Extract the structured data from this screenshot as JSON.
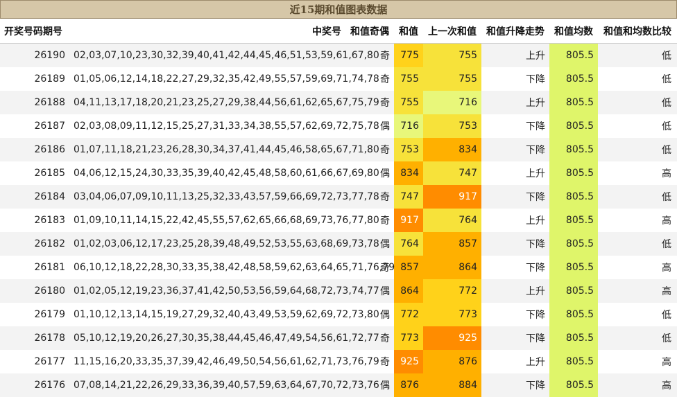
{
  "title": "近15期和值图表数据",
  "headers": {
    "issue": "开奖号码期号",
    "numbers": "中奖号",
    "odd_even": "和值奇偶",
    "sum": "和值",
    "prev_sum": "上一次和值",
    "trend": "和值升降走势",
    "avg": "和值均数",
    "compare": "和值和均数比较"
  },
  "colors": {
    "header_bg": "#d6c7a8",
    "avg_bg": "#dff56a",
    "sum_levels": {
      "very_low": "#e8f77a",
      "low": "#f7e23a",
      "mid": "#ffd21a",
      "high": "#ffb000",
      "very_high": "#ff8c00"
    }
  },
  "rows": [
    {
      "issue": "26190",
      "numbers": "02,03,07,10,23,30,32,39,40,41,42,44,45,46,51,53,59,61,67,80",
      "odd_even": "奇",
      "sum": "775",
      "prev_sum": "755",
      "trend": "上升",
      "avg": "805.5",
      "compare": "低"
    },
    {
      "issue": "26189",
      "numbers": "01,05,06,12,14,18,22,27,29,32,35,42,49,55,57,59,69,71,74,78",
      "odd_even": "奇",
      "sum": "755",
      "prev_sum": "755",
      "trend": "下降",
      "avg": "805.5",
      "compare": "低"
    },
    {
      "issue": "26188",
      "numbers": "04,11,13,17,18,20,21,23,25,27,29,38,44,56,61,62,65,67,75,79",
      "odd_even": "奇",
      "sum": "755",
      "prev_sum": "716",
      "trend": "上升",
      "avg": "805.5",
      "compare": "低"
    },
    {
      "issue": "26187",
      "numbers": "02,03,08,09,11,12,15,25,27,31,33,34,38,55,57,62,69,72,75,78",
      "odd_even": "偶",
      "sum": "716",
      "prev_sum": "753",
      "trend": "下降",
      "avg": "805.5",
      "compare": "低"
    },
    {
      "issue": "26186",
      "numbers": "01,07,11,18,21,23,26,28,30,34,37,41,44,45,46,58,65,67,71,80",
      "odd_even": "奇",
      "sum": "753",
      "prev_sum": "834",
      "trend": "下降",
      "avg": "805.5",
      "compare": "低"
    },
    {
      "issue": "26185",
      "numbers": "04,06,12,15,24,30,33,35,39,40,42,45,48,58,60,61,66,67,69,80",
      "odd_even": "偶",
      "sum": "834",
      "prev_sum": "747",
      "trend": "上升",
      "avg": "805.5",
      "compare": "高"
    },
    {
      "issue": "26184",
      "numbers": "03,04,06,07,09,10,11,13,25,32,33,43,57,59,66,69,72,73,77,78",
      "odd_even": "奇",
      "sum": "747",
      "prev_sum": "917",
      "trend": "下降",
      "avg": "805.5",
      "compare": "低"
    },
    {
      "issue": "26183",
      "numbers": "01,09,10,11,14,15,22,42,45,55,57,62,65,66,68,69,73,76,77,80",
      "odd_even": "奇",
      "sum": "917",
      "prev_sum": "764",
      "trend": "上升",
      "avg": "805.5",
      "compare": "高"
    },
    {
      "issue": "26182",
      "numbers": "01,02,03,06,12,17,23,25,28,39,48,49,52,53,55,63,68,69,73,78",
      "odd_even": "偶",
      "sum": "764",
      "prev_sum": "857",
      "trend": "下降",
      "avg": "805.5",
      "compare": "低"
    },
    {
      "issue": "26181",
      "numbers": "06,10,12,18,22,28,30,33,35,38,42,48,58,59,62,63,64,65,71,76,79",
      "odd_even": "奇",
      "sum": "857",
      "prev_sum": "864",
      "trend": "下降",
      "avg": "805.5",
      "compare": "高"
    },
    {
      "issue": "26180",
      "numbers": "01,02,05,12,19,23,36,37,41,42,50,53,56,59,64,68,72,73,74,77",
      "odd_even": "偶",
      "sum": "864",
      "prev_sum": "772",
      "trend": "上升",
      "avg": "805.5",
      "compare": "高"
    },
    {
      "issue": "26179",
      "numbers": "01,10,12,13,14,15,19,27,29,32,40,43,49,53,59,62,69,72,73,80",
      "odd_even": "偶",
      "sum": "772",
      "prev_sum": "773",
      "trend": "下降",
      "avg": "805.5",
      "compare": "低"
    },
    {
      "issue": "26178",
      "numbers": "05,10,12,19,20,26,27,30,35,38,44,45,46,47,49,54,56,61,72,77",
      "odd_even": "奇",
      "sum": "773",
      "prev_sum": "925",
      "trend": "下降",
      "avg": "805.5",
      "compare": "低"
    },
    {
      "issue": "26177",
      "numbers": "11,15,16,20,33,35,37,39,42,46,49,50,54,56,61,62,71,73,76,79",
      "odd_even": "奇",
      "sum": "925",
      "prev_sum": "876",
      "trend": "上升",
      "avg": "805.5",
      "compare": "高"
    },
    {
      "issue": "26176",
      "numbers": "07,08,14,21,22,26,29,33,36,39,40,57,59,63,64,67,70,72,73,76",
      "odd_even": "偶",
      "sum": "876",
      "prev_sum": "884",
      "trend": "下降",
      "avg": "805.5",
      "compare": "高"
    }
  ]
}
